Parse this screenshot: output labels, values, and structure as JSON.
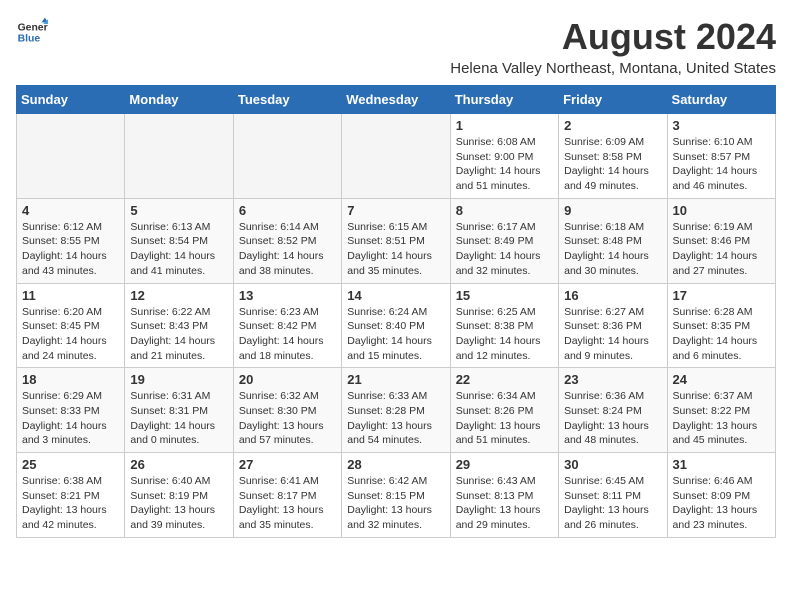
{
  "header": {
    "logo_general": "General",
    "logo_blue": "Blue",
    "title": "August 2024",
    "subtitle": "Helena Valley Northeast, Montana, United States"
  },
  "weekdays": [
    "Sunday",
    "Monday",
    "Tuesday",
    "Wednesday",
    "Thursday",
    "Friday",
    "Saturday"
  ],
  "weeks": [
    [
      {
        "day": "",
        "info": ""
      },
      {
        "day": "",
        "info": ""
      },
      {
        "day": "",
        "info": ""
      },
      {
        "day": "",
        "info": ""
      },
      {
        "day": "1",
        "info": "Sunrise: 6:08 AM\nSunset: 9:00 PM\nDaylight: 14 hours\nand 51 minutes."
      },
      {
        "day": "2",
        "info": "Sunrise: 6:09 AM\nSunset: 8:58 PM\nDaylight: 14 hours\nand 49 minutes."
      },
      {
        "day": "3",
        "info": "Sunrise: 6:10 AM\nSunset: 8:57 PM\nDaylight: 14 hours\nand 46 minutes."
      }
    ],
    [
      {
        "day": "4",
        "info": "Sunrise: 6:12 AM\nSunset: 8:55 PM\nDaylight: 14 hours\nand 43 minutes."
      },
      {
        "day": "5",
        "info": "Sunrise: 6:13 AM\nSunset: 8:54 PM\nDaylight: 14 hours\nand 41 minutes."
      },
      {
        "day": "6",
        "info": "Sunrise: 6:14 AM\nSunset: 8:52 PM\nDaylight: 14 hours\nand 38 minutes."
      },
      {
        "day": "7",
        "info": "Sunrise: 6:15 AM\nSunset: 8:51 PM\nDaylight: 14 hours\nand 35 minutes."
      },
      {
        "day": "8",
        "info": "Sunrise: 6:17 AM\nSunset: 8:49 PM\nDaylight: 14 hours\nand 32 minutes."
      },
      {
        "day": "9",
        "info": "Sunrise: 6:18 AM\nSunset: 8:48 PM\nDaylight: 14 hours\nand 30 minutes."
      },
      {
        "day": "10",
        "info": "Sunrise: 6:19 AM\nSunset: 8:46 PM\nDaylight: 14 hours\nand 27 minutes."
      }
    ],
    [
      {
        "day": "11",
        "info": "Sunrise: 6:20 AM\nSunset: 8:45 PM\nDaylight: 14 hours\nand 24 minutes."
      },
      {
        "day": "12",
        "info": "Sunrise: 6:22 AM\nSunset: 8:43 PM\nDaylight: 14 hours\nand 21 minutes."
      },
      {
        "day": "13",
        "info": "Sunrise: 6:23 AM\nSunset: 8:42 PM\nDaylight: 14 hours\nand 18 minutes."
      },
      {
        "day": "14",
        "info": "Sunrise: 6:24 AM\nSunset: 8:40 PM\nDaylight: 14 hours\nand 15 minutes."
      },
      {
        "day": "15",
        "info": "Sunrise: 6:25 AM\nSunset: 8:38 PM\nDaylight: 14 hours\nand 12 minutes."
      },
      {
        "day": "16",
        "info": "Sunrise: 6:27 AM\nSunset: 8:36 PM\nDaylight: 14 hours\nand 9 minutes."
      },
      {
        "day": "17",
        "info": "Sunrise: 6:28 AM\nSunset: 8:35 PM\nDaylight: 14 hours\nand 6 minutes."
      }
    ],
    [
      {
        "day": "18",
        "info": "Sunrise: 6:29 AM\nSunset: 8:33 PM\nDaylight: 14 hours\nand 3 minutes."
      },
      {
        "day": "19",
        "info": "Sunrise: 6:31 AM\nSunset: 8:31 PM\nDaylight: 14 hours\nand 0 minutes."
      },
      {
        "day": "20",
        "info": "Sunrise: 6:32 AM\nSunset: 8:30 PM\nDaylight: 13 hours\nand 57 minutes."
      },
      {
        "day": "21",
        "info": "Sunrise: 6:33 AM\nSunset: 8:28 PM\nDaylight: 13 hours\nand 54 minutes."
      },
      {
        "day": "22",
        "info": "Sunrise: 6:34 AM\nSunset: 8:26 PM\nDaylight: 13 hours\nand 51 minutes."
      },
      {
        "day": "23",
        "info": "Sunrise: 6:36 AM\nSunset: 8:24 PM\nDaylight: 13 hours\nand 48 minutes."
      },
      {
        "day": "24",
        "info": "Sunrise: 6:37 AM\nSunset: 8:22 PM\nDaylight: 13 hours\nand 45 minutes."
      }
    ],
    [
      {
        "day": "25",
        "info": "Sunrise: 6:38 AM\nSunset: 8:21 PM\nDaylight: 13 hours\nand 42 minutes."
      },
      {
        "day": "26",
        "info": "Sunrise: 6:40 AM\nSunset: 8:19 PM\nDaylight: 13 hours\nand 39 minutes."
      },
      {
        "day": "27",
        "info": "Sunrise: 6:41 AM\nSunset: 8:17 PM\nDaylight: 13 hours\nand 35 minutes."
      },
      {
        "day": "28",
        "info": "Sunrise: 6:42 AM\nSunset: 8:15 PM\nDaylight: 13 hours\nand 32 minutes."
      },
      {
        "day": "29",
        "info": "Sunrise: 6:43 AM\nSunset: 8:13 PM\nDaylight: 13 hours\nand 29 minutes."
      },
      {
        "day": "30",
        "info": "Sunrise: 6:45 AM\nSunset: 8:11 PM\nDaylight: 13 hours\nand 26 minutes."
      },
      {
        "day": "31",
        "info": "Sunrise: 6:46 AM\nSunset: 8:09 PM\nDaylight: 13 hours\nand 23 minutes."
      }
    ]
  ]
}
